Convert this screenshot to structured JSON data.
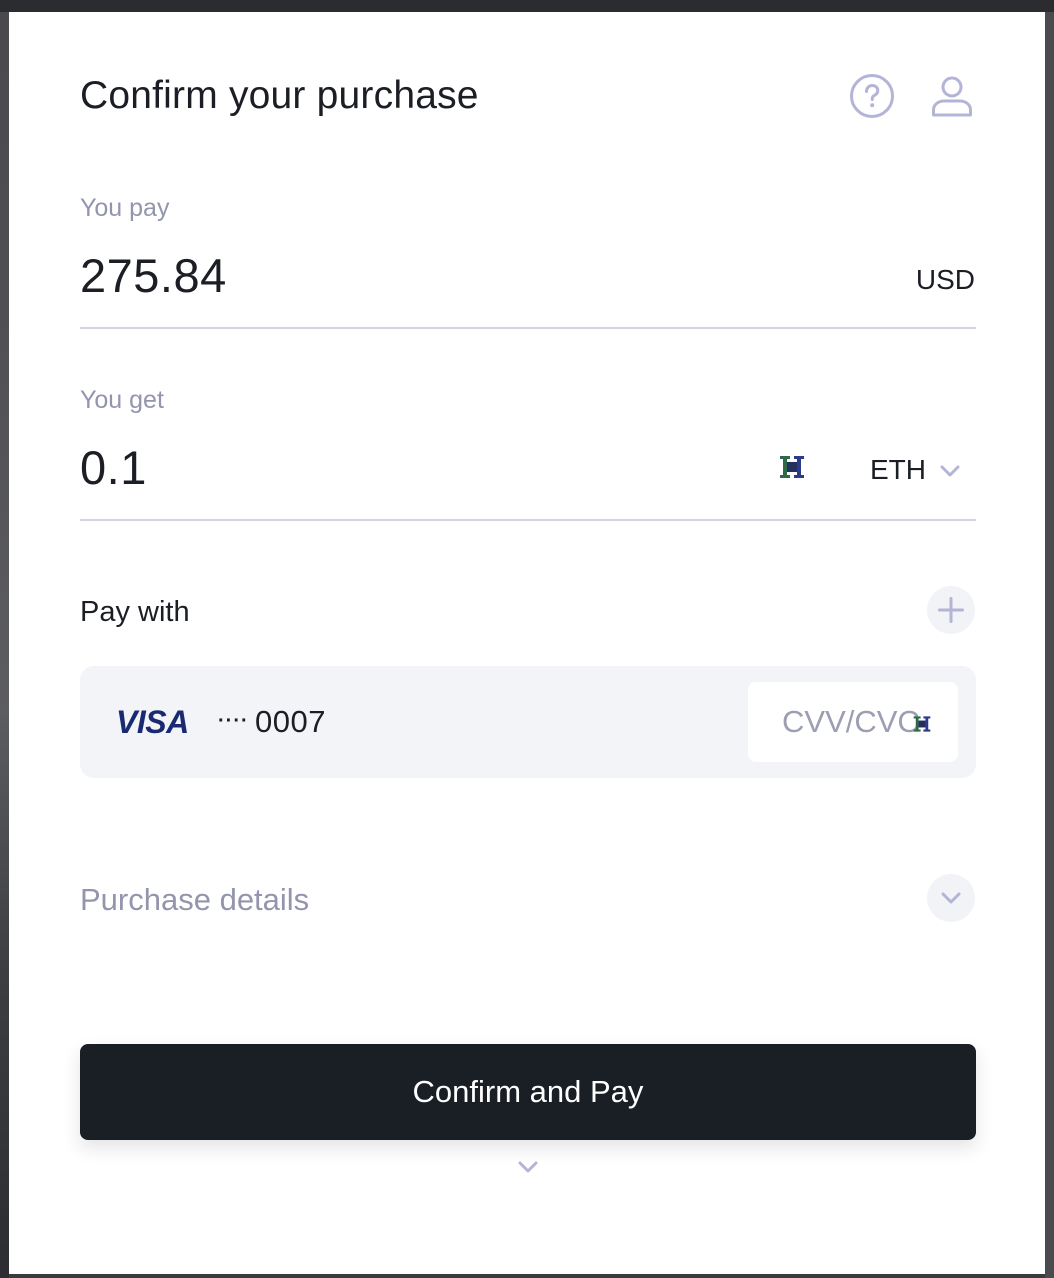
{
  "header": {
    "title": "Confirm your purchase",
    "help_icon": "question-circle-icon",
    "account_icon": "user-icon"
  },
  "pay": {
    "label": "You pay",
    "amount": "275.84",
    "currency": "USD"
  },
  "get": {
    "label": "You get",
    "amount": "0.1",
    "token": "ETH",
    "token_icon": "coin-icon",
    "dropdown_icon": "chevron-down-icon"
  },
  "payment": {
    "section_title": "Pay with",
    "add_icon": "plus-icon",
    "card": {
      "brand": "VISA",
      "masked": "····",
      "last4": "0007",
      "cvv_placeholder": "CVV/CVC"
    }
  },
  "details": {
    "label": "Purchase details",
    "toggle_icon": "chevron-down-icon"
  },
  "actions": {
    "confirm_label": "Confirm and Pay",
    "scroll_icon": "chevron-down-icon"
  },
  "colors": {
    "primary_text": "#1b1e24",
    "muted_text": "#9395ad",
    "button_bg": "#1a1e25",
    "card_bg": "#f3f4f8",
    "icon_accent": "#b3b4d6",
    "visa_blue": "#1a2a72"
  }
}
